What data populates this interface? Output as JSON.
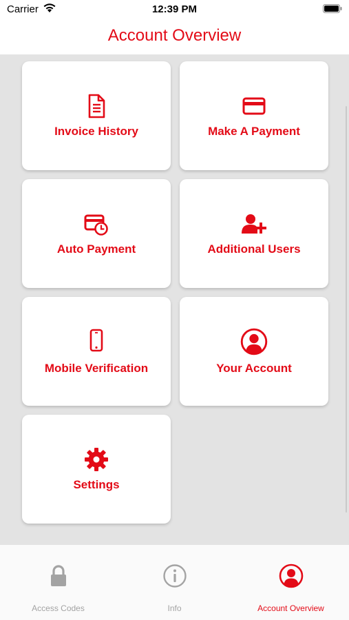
{
  "status_bar": {
    "carrier": "Carrier",
    "time": "12:39 PM"
  },
  "header": {
    "title": "Account Overview"
  },
  "tiles": [
    {
      "label": "Invoice History",
      "icon": "invoice-icon"
    },
    {
      "label": "Make A Payment",
      "icon": "credit-card-icon"
    },
    {
      "label": "Auto Payment",
      "icon": "auto-payment-icon"
    },
    {
      "label": "Additional Users",
      "icon": "add-user-icon"
    },
    {
      "label": "Mobile Verification",
      "icon": "mobile-phone-icon"
    },
    {
      "label": "Your Account",
      "icon": "user-circle-icon"
    },
    {
      "label": "Settings",
      "icon": "gear-icon"
    }
  ],
  "tab_bar": {
    "tabs": [
      {
        "label": "Access Codes",
        "icon": "lock-icon"
      },
      {
        "label": "Info",
        "icon": "info-icon"
      },
      {
        "label": "Account Overview",
        "icon": "user-circle-icon"
      }
    ],
    "active_index": 2
  },
  "colors": {
    "accent": "#e30b17",
    "background": "#e3e3e3",
    "inactive": "#a3a3a3"
  }
}
